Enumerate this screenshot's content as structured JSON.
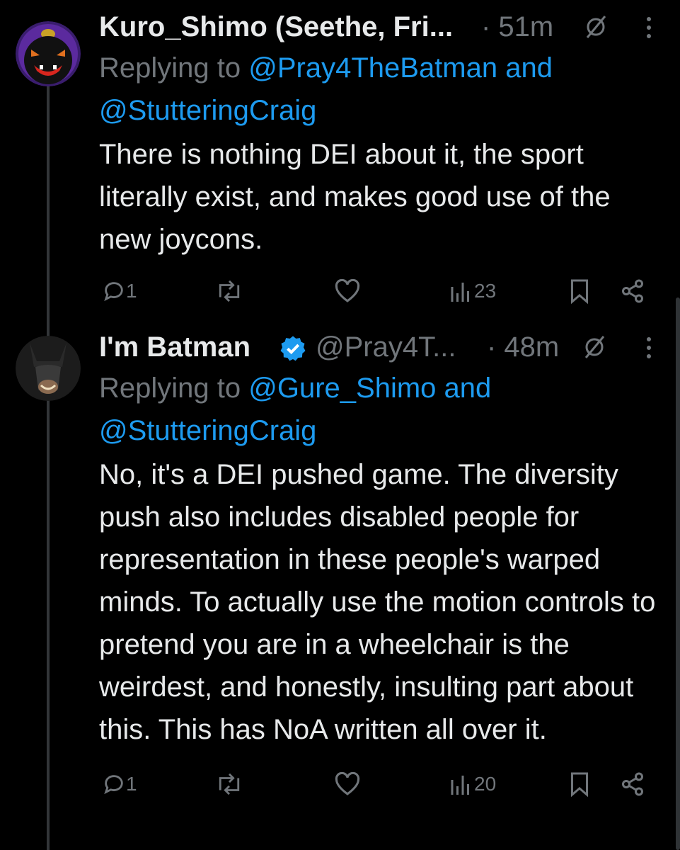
{
  "tweets": [
    {
      "name": "Kuro_Shimo (Seethe, Fri...",
      "time": "· 51m",
      "replying_prefix": "Replying to ",
      "replying_to_1": "@Pray4TheBatman and",
      "replying_to_2": "@StutteringCraig",
      "text": "There is nothing DEI about it, the sport literally exist, and makes good use of the new joycons.",
      "replies": "1",
      "views": "23",
      "avatar_icon": "purple-monster-avatar",
      "colors": {
        "avatar_ring": "#5b2a9e",
        "avatar_face": "#d7261e"
      }
    },
    {
      "name": "I'm Batman",
      "handle": "@Pray4T...",
      "time": "· 48m",
      "replying_prefix": "Replying to ",
      "replying_to_1": "@Gure_Shimo and",
      "replying_to_2": "@StutteringCraig",
      "text": "No, it's a DEI pushed game. The diversity push also includes disabled people for representation in these people's warped minds. To actually use the motion controls to pretend you are in a wheelchair is the weirdest, and honestly, insulting part about this. This has NoA written all over it.",
      "replies": "1",
      "views": "20",
      "avatar_icon": "batman-avatar",
      "verified": true
    }
  ],
  "colors": {
    "background": "#000000",
    "text": "#e7e9ea",
    "muted": "#71767b",
    "link": "#1d9bf0",
    "verified": "#1d9bf0"
  }
}
